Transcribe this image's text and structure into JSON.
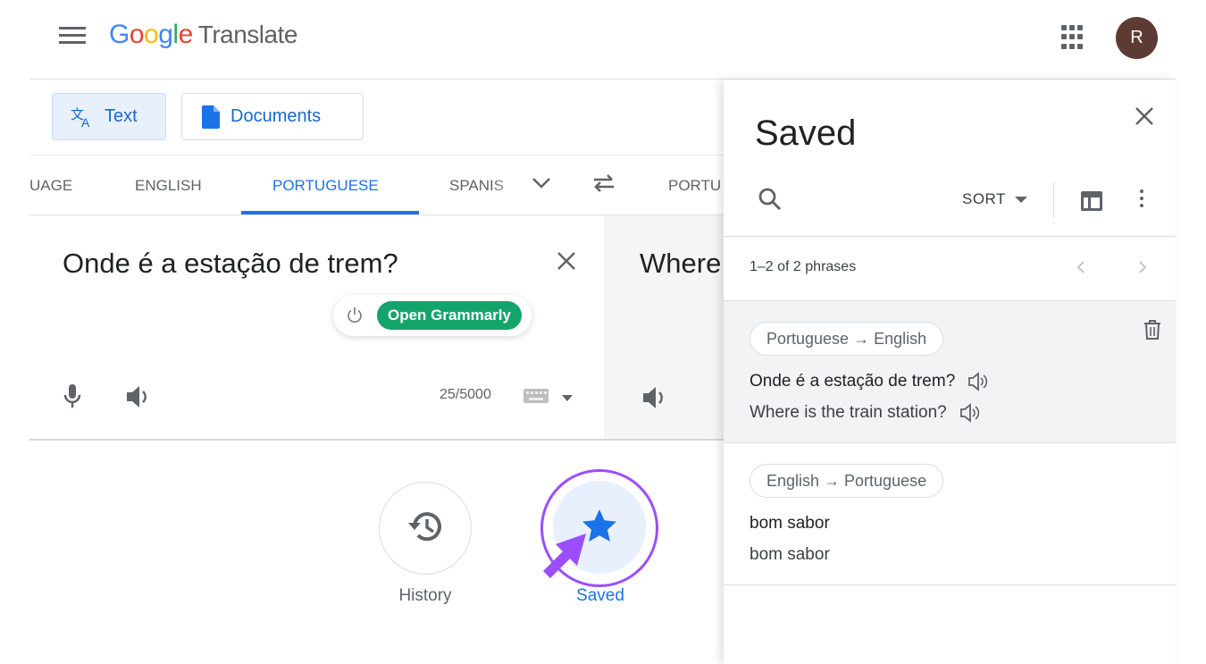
{
  "header": {
    "logo_letters": [
      "G",
      "o",
      "o",
      "g",
      "l",
      "e"
    ],
    "product": "Translate",
    "avatar_initial": "R"
  },
  "modes": {
    "text_label": "Text",
    "documents_label": "Documents"
  },
  "languages": {
    "source_tabs": [
      "UAGE",
      "ENGLISH",
      "PORTUGUESE",
      "SPANIS"
    ],
    "active_source": "PORTUGUESE",
    "target_tab": "PORTU"
  },
  "source": {
    "text": "Onde é a estação de trem?",
    "char_count": "25/5000"
  },
  "target": {
    "text": "Where"
  },
  "grammarly": {
    "button_label": "Open Grammarly"
  },
  "bottom": {
    "history_label": "History",
    "saved_label": "Saved"
  },
  "saved_panel": {
    "title": "Saved",
    "sort_label": "SORT",
    "count_label": "1–2 of 2 phrases",
    "entries": [
      {
        "language_pair": "Portuguese → English",
        "source": "Onde é a estação de trem?",
        "translation": "Where is the train station?"
      },
      {
        "language_pair": "English → Portuguese",
        "source": "bom sabor",
        "translation": "bom sabor"
      }
    ]
  },
  "colors": {
    "accent": "#1a73e8",
    "grammarly_green": "#15a36c",
    "highlight_ring": "#9b4dff",
    "avatar_bg": "#5d3a32"
  },
  "icons": [
    "menu-icon",
    "apps-icon",
    "translate-icon",
    "document-icon",
    "chevron-down-icon",
    "swap-icon",
    "close-icon",
    "power-icon",
    "microphone-icon",
    "speaker-icon",
    "keyboard-icon",
    "history-icon",
    "star-icon",
    "search-icon",
    "table-icon",
    "more-vert-icon",
    "chevron-left-icon",
    "chevron-right-icon",
    "trash-icon",
    "cursor-arrow-icon"
  ]
}
